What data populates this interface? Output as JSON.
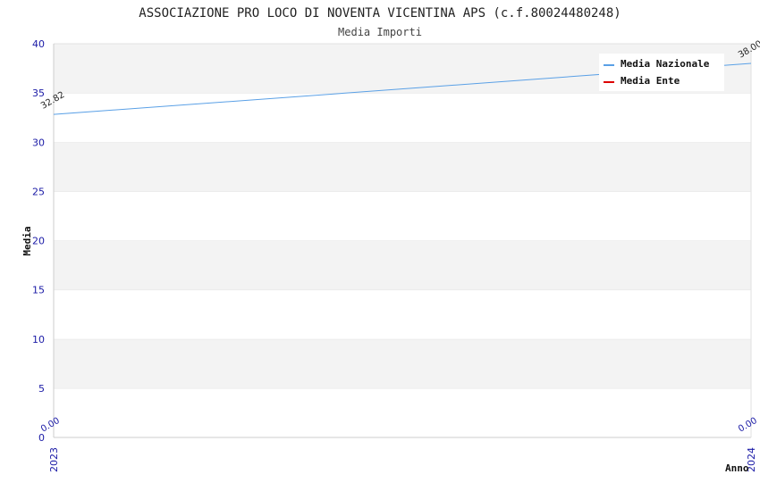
{
  "chart_data": {
    "type": "line",
    "title": "ASSOCIAZIONE PRO LOCO DI NOVENTA VICENTINA APS (c.f.80024480248)",
    "subtitle": "Media Importi",
    "xlabel": "Anno",
    "ylabel": "Media",
    "x": [
      "2023",
      "2024"
    ],
    "ylim": [
      0,
      40
    ],
    "yticks": [
      0,
      5,
      10,
      15,
      20,
      25,
      30,
      35,
      40
    ],
    "grid": true,
    "legend_position": "top-right",
    "series": [
      {
        "name": "Media Nazionale",
        "color": "#5aa0e6",
        "values": [
          32.82,
          38.0
        ],
        "labels": [
          "32.82",
          "38.00"
        ]
      },
      {
        "name": "Media Ente",
        "color": "#dd0000",
        "values": [
          0,
          0
        ],
        "labels": [
          "0.00",
          "0.00"
        ]
      }
    ]
  }
}
